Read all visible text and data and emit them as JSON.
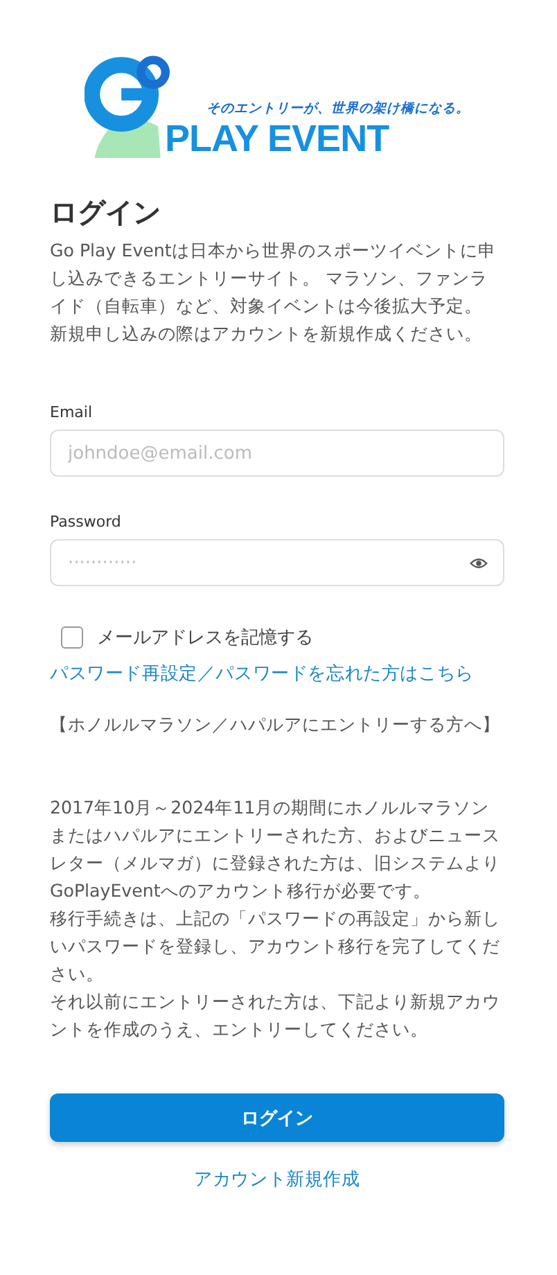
{
  "logo": {
    "tagline": "そのエントリーが、世界の架け橋になる。",
    "wordmark": "PLAY EVENT"
  },
  "title": "ログイン",
  "intro": [
    "Go Play Eventは日本から世界のスポーツイベントに申し込みできるエントリーサイト。 マラソン、ファンライド（自転車）など、対象イベントは今後拡大予定。",
    "新規申し込みの際はアカウントを新規作成ください。"
  ],
  "fields": [
    {
      "label": "Email",
      "placeholder": "johndoe@email.com",
      "kind": "text"
    },
    {
      "label": "Password",
      "placeholder": "············",
      "kind": "password"
    }
  ],
  "remember": {
    "label": "メールアドレスを記憶する",
    "checked": false
  },
  "reset_link": "パスワード再設定／パスワードを忘れた方はこちら",
  "notice": {
    "heading": "【ホノルルマラソン／ハパルアにエントリーする方へ】",
    "paragraphs": [
      "2017年10月～2024年11月の期間にホノルルマラソンまたはハパルアにエントリーされた方、およびニュースレター（メルマガ）に登録された方は、旧システムよりGoPlayEventへのアカウント移行が必要です。",
      "移行手続きは、上記の「パスワードの再設定」から新しいパスワードを登録し、アカウント移行を完了してください。",
      "それ以前にエントリーされた方は、下記より新規アカウントを作成のうえ、エントリーしてください。"
    ]
  },
  "login_button": "ログイン",
  "signup_link": "アカウント新規作成"
}
